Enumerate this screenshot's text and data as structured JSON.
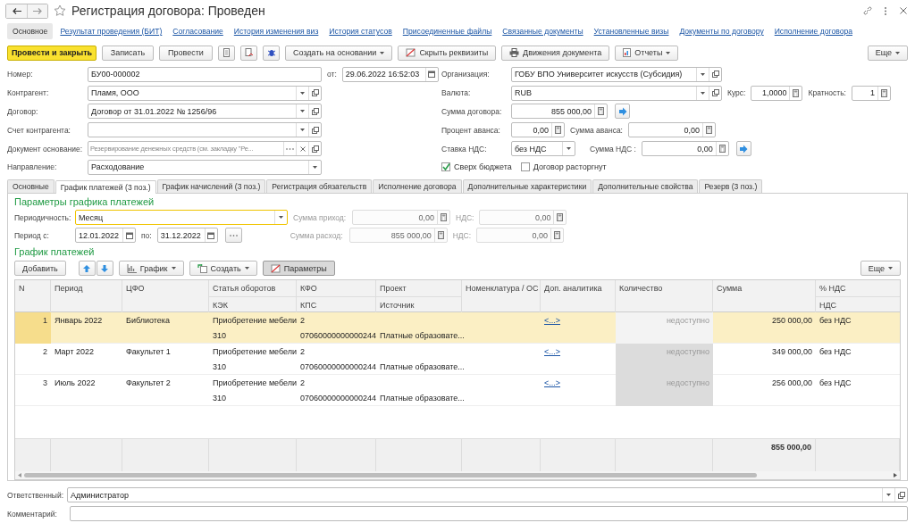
{
  "window": {
    "title": "Регистрация договора: Проведен"
  },
  "nav_links": [
    {
      "label": "Основное",
      "selected": true
    },
    {
      "label": "Результат проведения (БИТ)",
      "selected": false
    },
    {
      "label": "Согласование",
      "selected": false
    },
    {
      "label": "История изменения виз",
      "selected": false
    },
    {
      "label": "История статусов",
      "selected": false
    },
    {
      "label": "Присоединенные файлы",
      "selected": false
    },
    {
      "label": "Связанные документы",
      "selected": false
    },
    {
      "label": "Установленные визы",
      "selected": false
    },
    {
      "label": "Документы по договору",
      "selected": false
    },
    {
      "label": "Исполнение договора",
      "selected": false
    }
  ],
  "toolbar": {
    "left_buttons": [
      {
        "label": "Провести и закрыть",
        "kind": "primary"
      },
      {
        "label": "Записать",
        "kind": "plain"
      },
      {
        "label": "Провести",
        "kind": "plain"
      }
    ],
    "right_buttons": [
      {
        "label": "Создать на основании",
        "kind": "menu"
      },
      {
        "label": "Скрыть реквизиты",
        "kind": "hide"
      },
      {
        "label": "Движения документа",
        "kind": "print"
      },
      {
        "label": "Отчеты",
        "kind": "report"
      }
    ],
    "more": "Еще"
  },
  "header": {
    "number": {
      "label": "Номер:",
      "value": "БУ00-000002"
    },
    "date": {
      "label": "от:",
      "value": "29.06.2022 16:52:03"
    },
    "left_fields": [
      {
        "label": "Контрагент:",
        "value": "Пламя, ООО",
        "kind": "ref"
      },
      {
        "label": "Договор:",
        "value": "Договор от 31.01.2022 № 1256/96",
        "kind": "ref"
      },
      {
        "label": "Счет контрагента:",
        "kind": "ref"
      },
      {
        "label": "Документ основание:",
        "placeholder": "Резервирование денежных средств (см. закладку \"Ре...",
        "kind": "basis"
      },
      {
        "label": "Направление:",
        "value": "Расходование",
        "kind": "select"
      }
    ],
    "organization": {
      "label": "Организация:",
      "value": "ГОБУ ВПО Университет искусств (Субсидия)"
    },
    "currency": {
      "label": "Валюта:",
      "value": "RUB"
    },
    "rate": {
      "label": "Курс:",
      "value": "1,0000"
    },
    "multiplicity": {
      "label": "Кратность:",
      "value": "1"
    },
    "contract_sum": {
      "label": "Сумма договора:",
      "value": "855 000,00"
    },
    "advance_percent": {
      "label": "Процент аванса:",
      "value": "0,00"
    },
    "advance_sum": {
      "label": "Сумма аванса:",
      "value": "0,00"
    },
    "vat_rate": {
      "label": "Ставка НДС:",
      "value": "без НДС"
    },
    "vat_sum": {
      "label": "Сумма НДС  :",
      "value": "0,00"
    },
    "checkboxes": [
      {
        "label": "Сверх бюджета",
        "checked": true
      },
      {
        "label": "Договор расторгнут",
        "checked": false
      }
    ]
  },
  "tabs": [
    {
      "label": "Основные",
      "selected": false
    },
    {
      "label": "График платежей (3 поз.)",
      "selected": true
    },
    {
      "label": "График начислений (3 поз.)",
      "selected": false
    },
    {
      "label": "Регистрация обязательств",
      "selected": false
    },
    {
      "label": "Исполнение договора",
      "selected": false
    },
    {
      "label": "Дополнительные характеристики",
      "selected": false
    },
    {
      "label": "Дополнительные свойства",
      "selected": false
    },
    {
      "label": "Резерв (3 поз.)",
      "selected": false
    }
  ],
  "schedule_params": {
    "title": "Параметры графика платежей",
    "periodicity": {
      "label": "Периодичность:",
      "value": "Месяц",
      "focused": true
    },
    "income": {
      "label": "Сумма приход:",
      "value": "0,00",
      "disabled": true
    },
    "income_vat": {
      "label": "НДС:",
      "value": "0,00",
      "disabled": true
    },
    "period_from": {
      "label": "Период с:",
      "value": "12.01.2022"
    },
    "period_to": {
      "label": "по:",
      "value": "31.12.2022"
    },
    "expense": {
      "label": "Сумма расход:",
      "value": "855 000,00",
      "disabled": true
    },
    "expense_vat": {
      "label": "НДС:",
      "value": "0,00",
      "disabled": true
    }
  },
  "schedule": {
    "title": "График платежей",
    "buttons": [
      {
        "label": "Добавить",
        "kind": "plain",
        "pressed": false
      },
      {
        "label": "График",
        "kind": "chart",
        "pressed": false
      },
      {
        "label": "Создать",
        "kind": "create",
        "pressed": false
      },
      {
        "label": "Параметры",
        "kind": "params",
        "pressed": true
      }
    ],
    "more": "Еще",
    "columns": [
      {
        "top": "N"
      },
      {
        "top": "Период"
      },
      {
        "top": "ЦФО"
      },
      {
        "top": "Статья оборотов",
        "bottom": "КЭК"
      },
      {
        "top": "КФО",
        "bottom": "КПС"
      },
      {
        "top": "Проект",
        "bottom": "Источник"
      },
      {
        "top": "Номенклатура / ОС"
      },
      {
        "top": "Доп. аналитика"
      },
      {
        "top": "Количество"
      },
      {
        "top": "Сумма"
      },
      {
        "top": "% НДС",
        "bottom": "НДС"
      }
    ],
    "rows": [
      {
        "selected": true,
        "n": "1",
        "period": "Январь 2022",
        "cfo": "Библиотека",
        "article": "Приобретение мебели",
        "kek": "310",
        "kfo": "2",
        "kps": "07060000000000244",
        "source": "Платные образовате...",
        "analytics": "<...>",
        "quantity": "недоступно",
        "sum": "250 000,00",
        "vat_rate": "без НДС"
      },
      {
        "selected": false,
        "n": "2",
        "period": "Март 2022",
        "cfo": "Факультет 1",
        "article": "Приобретение мебели",
        "kek": "310",
        "kfo": "2",
        "kps": "07060000000000244",
        "source": "Платные образовате...",
        "analytics": "<...>",
        "quantity": "недоступно",
        "sum": "349 000,00",
        "vat_rate": "без НДС"
      },
      {
        "selected": false,
        "n": "3",
        "period": "Июль 2022",
        "cfo": "Факультет 2",
        "article": "Приобретение мебели",
        "kek": "310",
        "kfo": "2",
        "kps": "07060000000000244",
        "source": "Платные образовате...",
        "analytics": "<...>",
        "quantity": "недоступно",
        "sum": "256 000,00",
        "vat_rate": "без НДС"
      }
    ],
    "total": "855 000,00"
  },
  "responsible": {
    "label": "Ответственный:",
    "value": "Администратор"
  },
  "comment": {
    "label": "Комментарий:"
  }
}
